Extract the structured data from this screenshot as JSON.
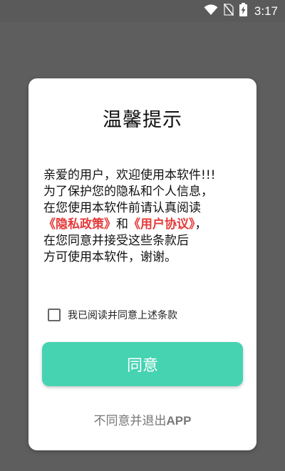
{
  "status_bar": {
    "time": "3:17",
    "icons": [
      "wifi-icon",
      "no-sim-icon",
      "battery-charging-icon"
    ]
  },
  "dialog": {
    "title": "温馨提示",
    "body": {
      "line1": "亲爱的用户，欢迎使用本软件!!!",
      "line2": "为了保护您的隐私和个人信息，",
      "line3": "在您使用本软件前请认真阅读",
      "privacy_link": "《隐私政策》",
      "and": "和",
      "agreement_link": "《用户协议》",
      "line4_tail": "，",
      "line5": "在您同意并接受这些条款后",
      "line6": "方可使用本软件，谢谢。"
    },
    "checkbox_label": "我已阅读并同意上述条款",
    "agree_button": "同意",
    "exit_prefix": "不同意并退出",
    "exit_app": "APP"
  },
  "colors": {
    "accent": "#46d3b2",
    "link": "#e53b3b",
    "overlay": "#5e5e5e"
  }
}
